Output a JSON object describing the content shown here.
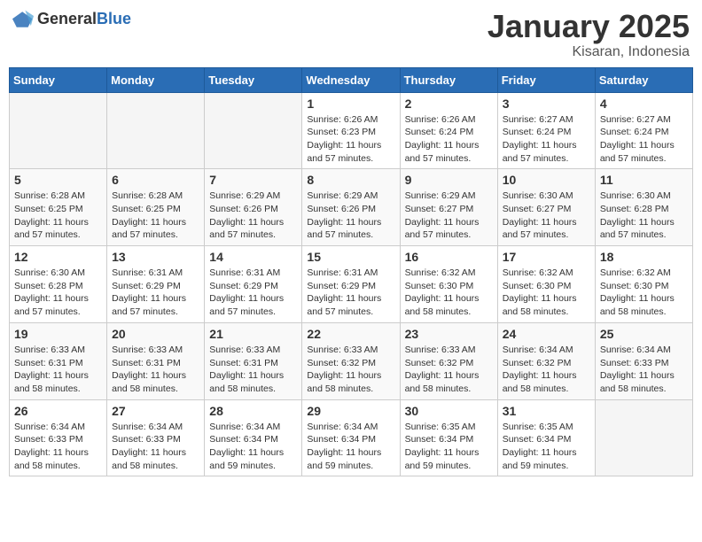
{
  "header": {
    "logo": {
      "general": "General",
      "blue": "Blue"
    },
    "title": "January 2025",
    "location": "Kisaran, Indonesia"
  },
  "weekdays": [
    "Sunday",
    "Monday",
    "Tuesday",
    "Wednesday",
    "Thursday",
    "Friday",
    "Saturday"
  ],
  "weeks": [
    [
      {
        "day": "",
        "info": ""
      },
      {
        "day": "",
        "info": ""
      },
      {
        "day": "",
        "info": ""
      },
      {
        "day": "1",
        "info": "Sunrise: 6:26 AM\nSunset: 6:23 PM\nDaylight: 11 hours and 57 minutes."
      },
      {
        "day": "2",
        "info": "Sunrise: 6:26 AM\nSunset: 6:24 PM\nDaylight: 11 hours and 57 minutes."
      },
      {
        "day": "3",
        "info": "Sunrise: 6:27 AM\nSunset: 6:24 PM\nDaylight: 11 hours and 57 minutes."
      },
      {
        "day": "4",
        "info": "Sunrise: 6:27 AM\nSunset: 6:24 PM\nDaylight: 11 hours and 57 minutes."
      }
    ],
    [
      {
        "day": "5",
        "info": "Sunrise: 6:28 AM\nSunset: 6:25 PM\nDaylight: 11 hours and 57 minutes."
      },
      {
        "day": "6",
        "info": "Sunrise: 6:28 AM\nSunset: 6:25 PM\nDaylight: 11 hours and 57 minutes."
      },
      {
        "day": "7",
        "info": "Sunrise: 6:29 AM\nSunset: 6:26 PM\nDaylight: 11 hours and 57 minutes."
      },
      {
        "day": "8",
        "info": "Sunrise: 6:29 AM\nSunset: 6:26 PM\nDaylight: 11 hours and 57 minutes."
      },
      {
        "day": "9",
        "info": "Sunrise: 6:29 AM\nSunset: 6:27 PM\nDaylight: 11 hours and 57 minutes."
      },
      {
        "day": "10",
        "info": "Sunrise: 6:30 AM\nSunset: 6:27 PM\nDaylight: 11 hours and 57 minutes."
      },
      {
        "day": "11",
        "info": "Sunrise: 6:30 AM\nSunset: 6:28 PM\nDaylight: 11 hours and 57 minutes."
      }
    ],
    [
      {
        "day": "12",
        "info": "Sunrise: 6:30 AM\nSunset: 6:28 PM\nDaylight: 11 hours and 57 minutes."
      },
      {
        "day": "13",
        "info": "Sunrise: 6:31 AM\nSunset: 6:29 PM\nDaylight: 11 hours and 57 minutes."
      },
      {
        "day": "14",
        "info": "Sunrise: 6:31 AM\nSunset: 6:29 PM\nDaylight: 11 hours and 57 minutes."
      },
      {
        "day": "15",
        "info": "Sunrise: 6:31 AM\nSunset: 6:29 PM\nDaylight: 11 hours and 57 minutes."
      },
      {
        "day": "16",
        "info": "Sunrise: 6:32 AM\nSunset: 6:30 PM\nDaylight: 11 hours and 58 minutes."
      },
      {
        "day": "17",
        "info": "Sunrise: 6:32 AM\nSunset: 6:30 PM\nDaylight: 11 hours and 58 minutes."
      },
      {
        "day": "18",
        "info": "Sunrise: 6:32 AM\nSunset: 6:30 PM\nDaylight: 11 hours and 58 minutes."
      }
    ],
    [
      {
        "day": "19",
        "info": "Sunrise: 6:33 AM\nSunset: 6:31 PM\nDaylight: 11 hours and 58 minutes."
      },
      {
        "day": "20",
        "info": "Sunrise: 6:33 AM\nSunset: 6:31 PM\nDaylight: 11 hours and 58 minutes."
      },
      {
        "day": "21",
        "info": "Sunrise: 6:33 AM\nSunset: 6:31 PM\nDaylight: 11 hours and 58 minutes."
      },
      {
        "day": "22",
        "info": "Sunrise: 6:33 AM\nSunset: 6:32 PM\nDaylight: 11 hours and 58 minutes."
      },
      {
        "day": "23",
        "info": "Sunrise: 6:33 AM\nSunset: 6:32 PM\nDaylight: 11 hours and 58 minutes."
      },
      {
        "day": "24",
        "info": "Sunrise: 6:34 AM\nSunset: 6:32 PM\nDaylight: 11 hours and 58 minutes."
      },
      {
        "day": "25",
        "info": "Sunrise: 6:34 AM\nSunset: 6:33 PM\nDaylight: 11 hours and 58 minutes."
      }
    ],
    [
      {
        "day": "26",
        "info": "Sunrise: 6:34 AM\nSunset: 6:33 PM\nDaylight: 11 hours and 58 minutes."
      },
      {
        "day": "27",
        "info": "Sunrise: 6:34 AM\nSunset: 6:33 PM\nDaylight: 11 hours and 58 minutes."
      },
      {
        "day": "28",
        "info": "Sunrise: 6:34 AM\nSunset: 6:34 PM\nDaylight: 11 hours and 59 minutes."
      },
      {
        "day": "29",
        "info": "Sunrise: 6:34 AM\nSunset: 6:34 PM\nDaylight: 11 hours and 59 minutes."
      },
      {
        "day": "30",
        "info": "Sunrise: 6:35 AM\nSunset: 6:34 PM\nDaylight: 11 hours and 59 minutes."
      },
      {
        "day": "31",
        "info": "Sunrise: 6:35 AM\nSunset: 6:34 PM\nDaylight: 11 hours and 59 minutes."
      },
      {
        "day": "",
        "info": ""
      }
    ]
  ]
}
